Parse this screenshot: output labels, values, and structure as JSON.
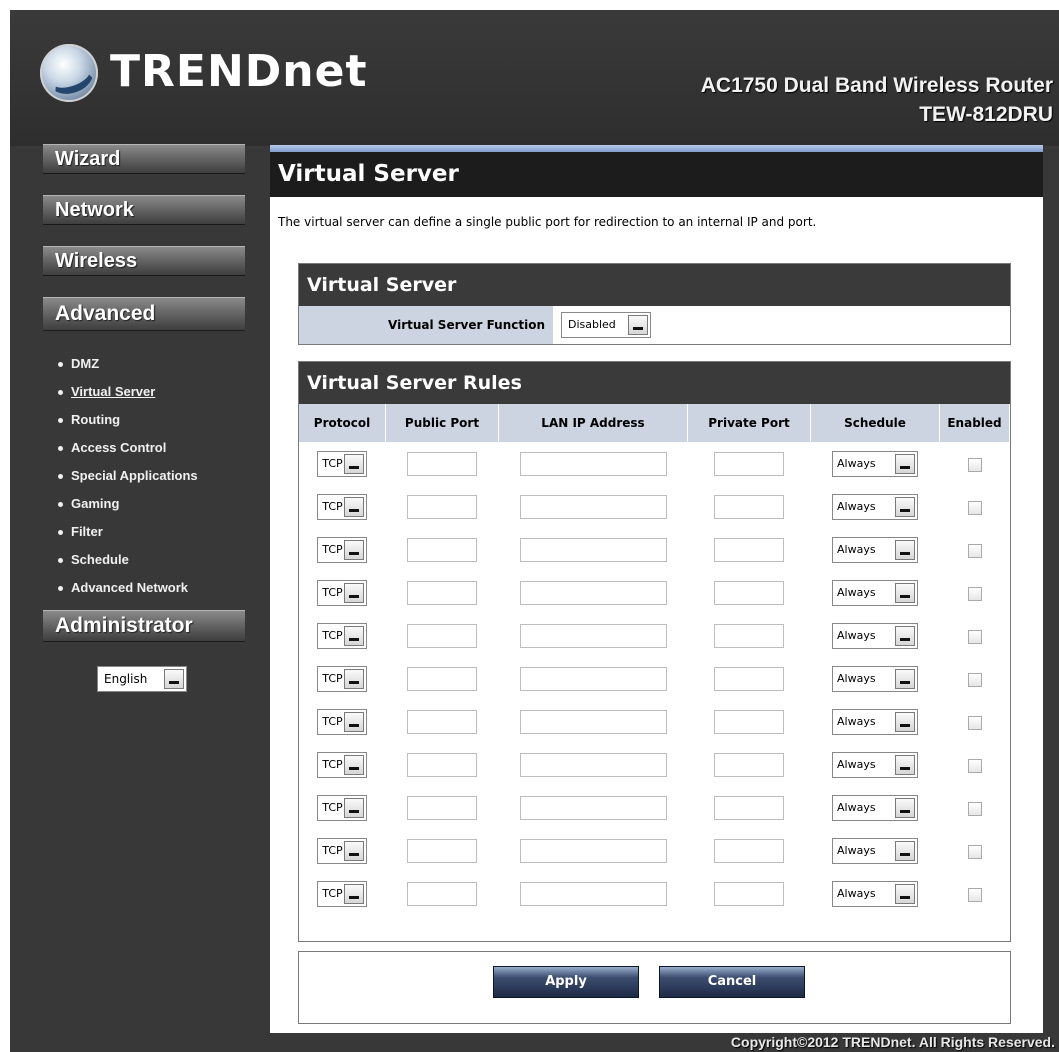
{
  "header": {
    "logo_text": "TRENDnet",
    "product": "AC1750 Dual Band Wireless Router",
    "model": "TEW-812DRU"
  },
  "sidebar": {
    "wizard": "Wizard",
    "network": "Network",
    "wireless": "Wireless",
    "advanced": "Advanced",
    "administrator": "Administrator",
    "submenu": [
      "DMZ",
      "Virtual Server",
      "Routing",
      "Access Control",
      "Special Applications",
      "Gaming",
      "Filter",
      "Schedule",
      "Advanced Network"
    ],
    "active_item": "Virtual Server",
    "language": "English"
  },
  "main": {
    "title": "Virtual Server",
    "description": "The virtual server can define a single public port for redirection to an internal IP and port.",
    "vs_section": {
      "title": "Virtual Server",
      "function_label": "Virtual Server Function",
      "function_value": "Disabled"
    },
    "rules_section": {
      "title": "Virtual Server Rules",
      "columns": [
        "Protocol",
        "Public Port",
        "LAN IP Address",
        "Private Port",
        "Schedule",
        "Enabled"
      ],
      "rows": [
        {
          "protocol": "TCP",
          "public_port": "",
          "lan_ip": "",
          "private_port": "",
          "schedule": "Always",
          "enabled": false
        },
        {
          "protocol": "TCP",
          "public_port": "",
          "lan_ip": "",
          "private_port": "",
          "schedule": "Always",
          "enabled": false
        },
        {
          "protocol": "TCP",
          "public_port": "",
          "lan_ip": "",
          "private_port": "",
          "schedule": "Always",
          "enabled": false
        },
        {
          "protocol": "TCP",
          "public_port": "",
          "lan_ip": "",
          "private_port": "",
          "schedule": "Always",
          "enabled": false
        },
        {
          "protocol": "TCP",
          "public_port": "",
          "lan_ip": "",
          "private_port": "",
          "schedule": "Always",
          "enabled": false
        },
        {
          "protocol": "TCP",
          "public_port": "",
          "lan_ip": "",
          "private_port": "",
          "schedule": "Always",
          "enabled": false
        },
        {
          "protocol": "TCP",
          "public_port": "",
          "lan_ip": "",
          "private_port": "",
          "schedule": "Always",
          "enabled": false
        },
        {
          "protocol": "TCP",
          "public_port": "",
          "lan_ip": "",
          "private_port": "",
          "schedule": "Always",
          "enabled": false
        },
        {
          "protocol": "TCP",
          "public_port": "",
          "lan_ip": "",
          "private_port": "",
          "schedule": "Always",
          "enabled": false
        },
        {
          "protocol": "TCP",
          "public_port": "",
          "lan_ip": "",
          "private_port": "",
          "schedule": "Always",
          "enabled": false
        },
        {
          "protocol": "TCP",
          "public_port": "",
          "lan_ip": "",
          "private_port": "",
          "schedule": "Always",
          "enabled": false
        }
      ]
    },
    "buttons": {
      "apply": "Apply",
      "cancel": "Cancel"
    }
  },
  "footer": {
    "copyright": "Copyright©2012 TRENDnet. All Rights Reserved."
  }
}
